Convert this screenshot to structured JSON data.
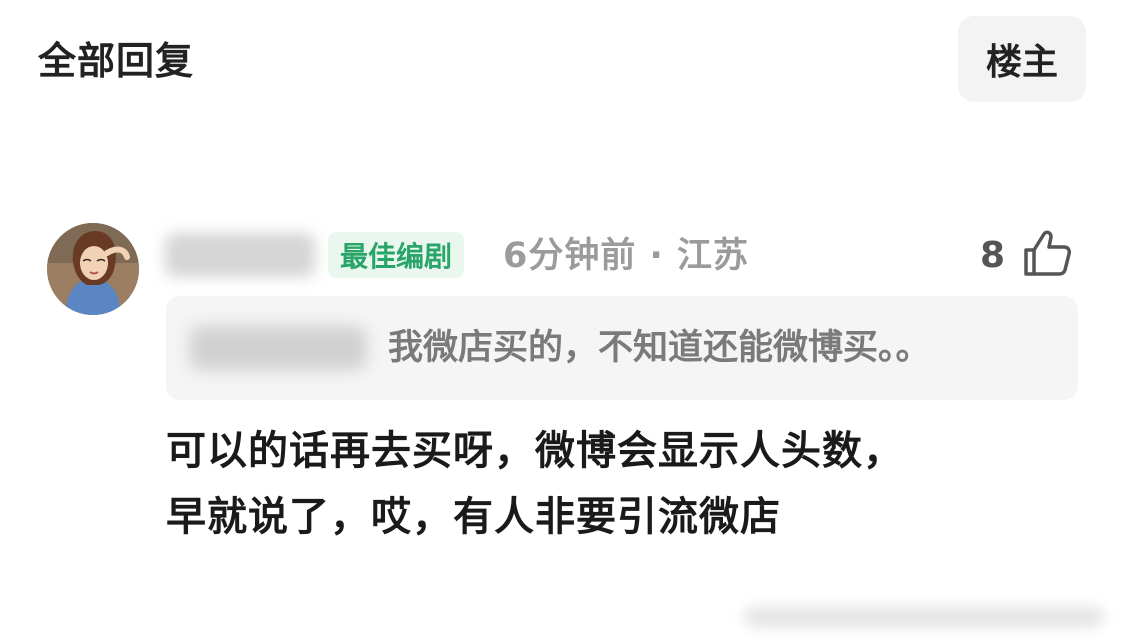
{
  "header": {
    "title": "全部回复",
    "op_label": "楼主"
  },
  "comment": {
    "badge": "最佳编剧",
    "meta": "6分钟前 · 江苏",
    "like_count": "8",
    "quote_text": "我微店买的，不知道还能微博买。。",
    "reply_lines": [
      "可以的话再去买呀，微博会显示人头数，",
      "早就说了，哎，有人非要引流微店"
    ]
  },
  "colors": {
    "badge_bg": "#e9f7ef",
    "badge_text": "#2aa569",
    "meta_text": "#9b9b9b",
    "quote_bg": "#f5f5f5"
  },
  "icons": {
    "like": "thumbs-up-icon",
    "avatar": "avatar"
  }
}
